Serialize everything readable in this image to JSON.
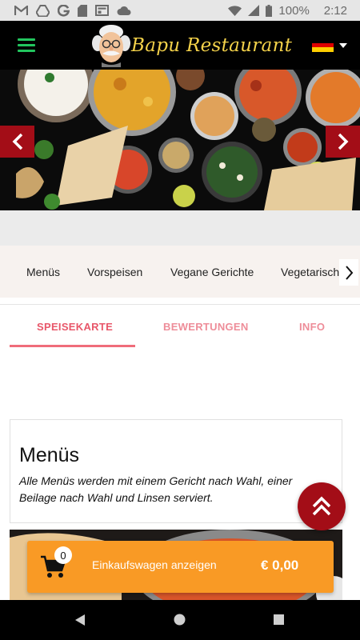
{
  "status_bar": {
    "notification_icons": [
      "gmail-icon",
      "drive-icon",
      "google-icon",
      "sd-card-icon",
      "news-icon",
      "cloud-icon"
    ],
    "battery": "100%",
    "time": "2:12"
  },
  "header": {
    "brand": "Bapu Restaurant",
    "menu_icon": "hamburger-icon",
    "language_flag": "germany-flag",
    "colors": {
      "background": "#000000",
      "menu": "#22c55e",
      "brand": "#f4d24a"
    }
  },
  "hero": {
    "prev_icon": "chevron-left-icon",
    "next_icon": "chevron-right-icon",
    "arrow_color": "#a30d17"
  },
  "categories": {
    "items": [
      "Menüs",
      "Vorspeisen",
      "Vegane Gerichte",
      "Vegetarisch"
    ],
    "next_icon": "chevron-right-icon"
  },
  "tabs": {
    "items": [
      {
        "label": "SPEISEKARTE",
        "active": true
      },
      {
        "label": "BEWERTUNGEN",
        "active": false
      },
      {
        "label": "INFO",
        "active": false
      }
    ],
    "active_color": "#e8576a"
  },
  "section": {
    "title": "Menüs",
    "description": "Alle Menüs werden mit einem Gericht nach Wahl, einer Beilage nach Wahl und Linsen serviert."
  },
  "cart": {
    "count": "0",
    "label": "Einkaufswagen anzeigen",
    "total": "€ 0,00",
    "color": "#f99a25"
  },
  "scroll_top_icon": "double-chevron-up-icon",
  "nav_bar": {
    "buttons": [
      "back-icon",
      "home-icon",
      "recents-icon"
    ]
  }
}
